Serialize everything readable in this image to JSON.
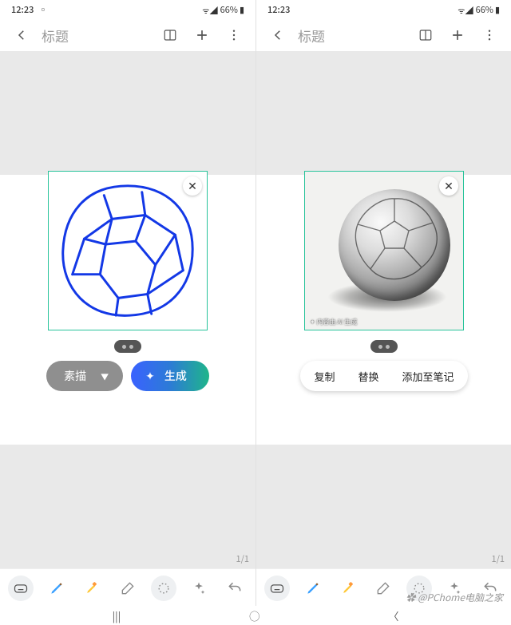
{
  "status": {
    "time": "12:23",
    "battery": "66%"
  },
  "header": {
    "title": "标题"
  },
  "page_indicator": "1/1",
  "left": {
    "style_label": "素描",
    "generate_label": "生成",
    "ai_tag": ""
  },
  "right": {
    "copy_label": "复制",
    "replace_label": "替换",
    "add_to_note_label": "添加至笔记",
    "ai_tag": "✦ 内容由 AI 生成"
  },
  "watermark": "✿ @PChome电脑之家"
}
